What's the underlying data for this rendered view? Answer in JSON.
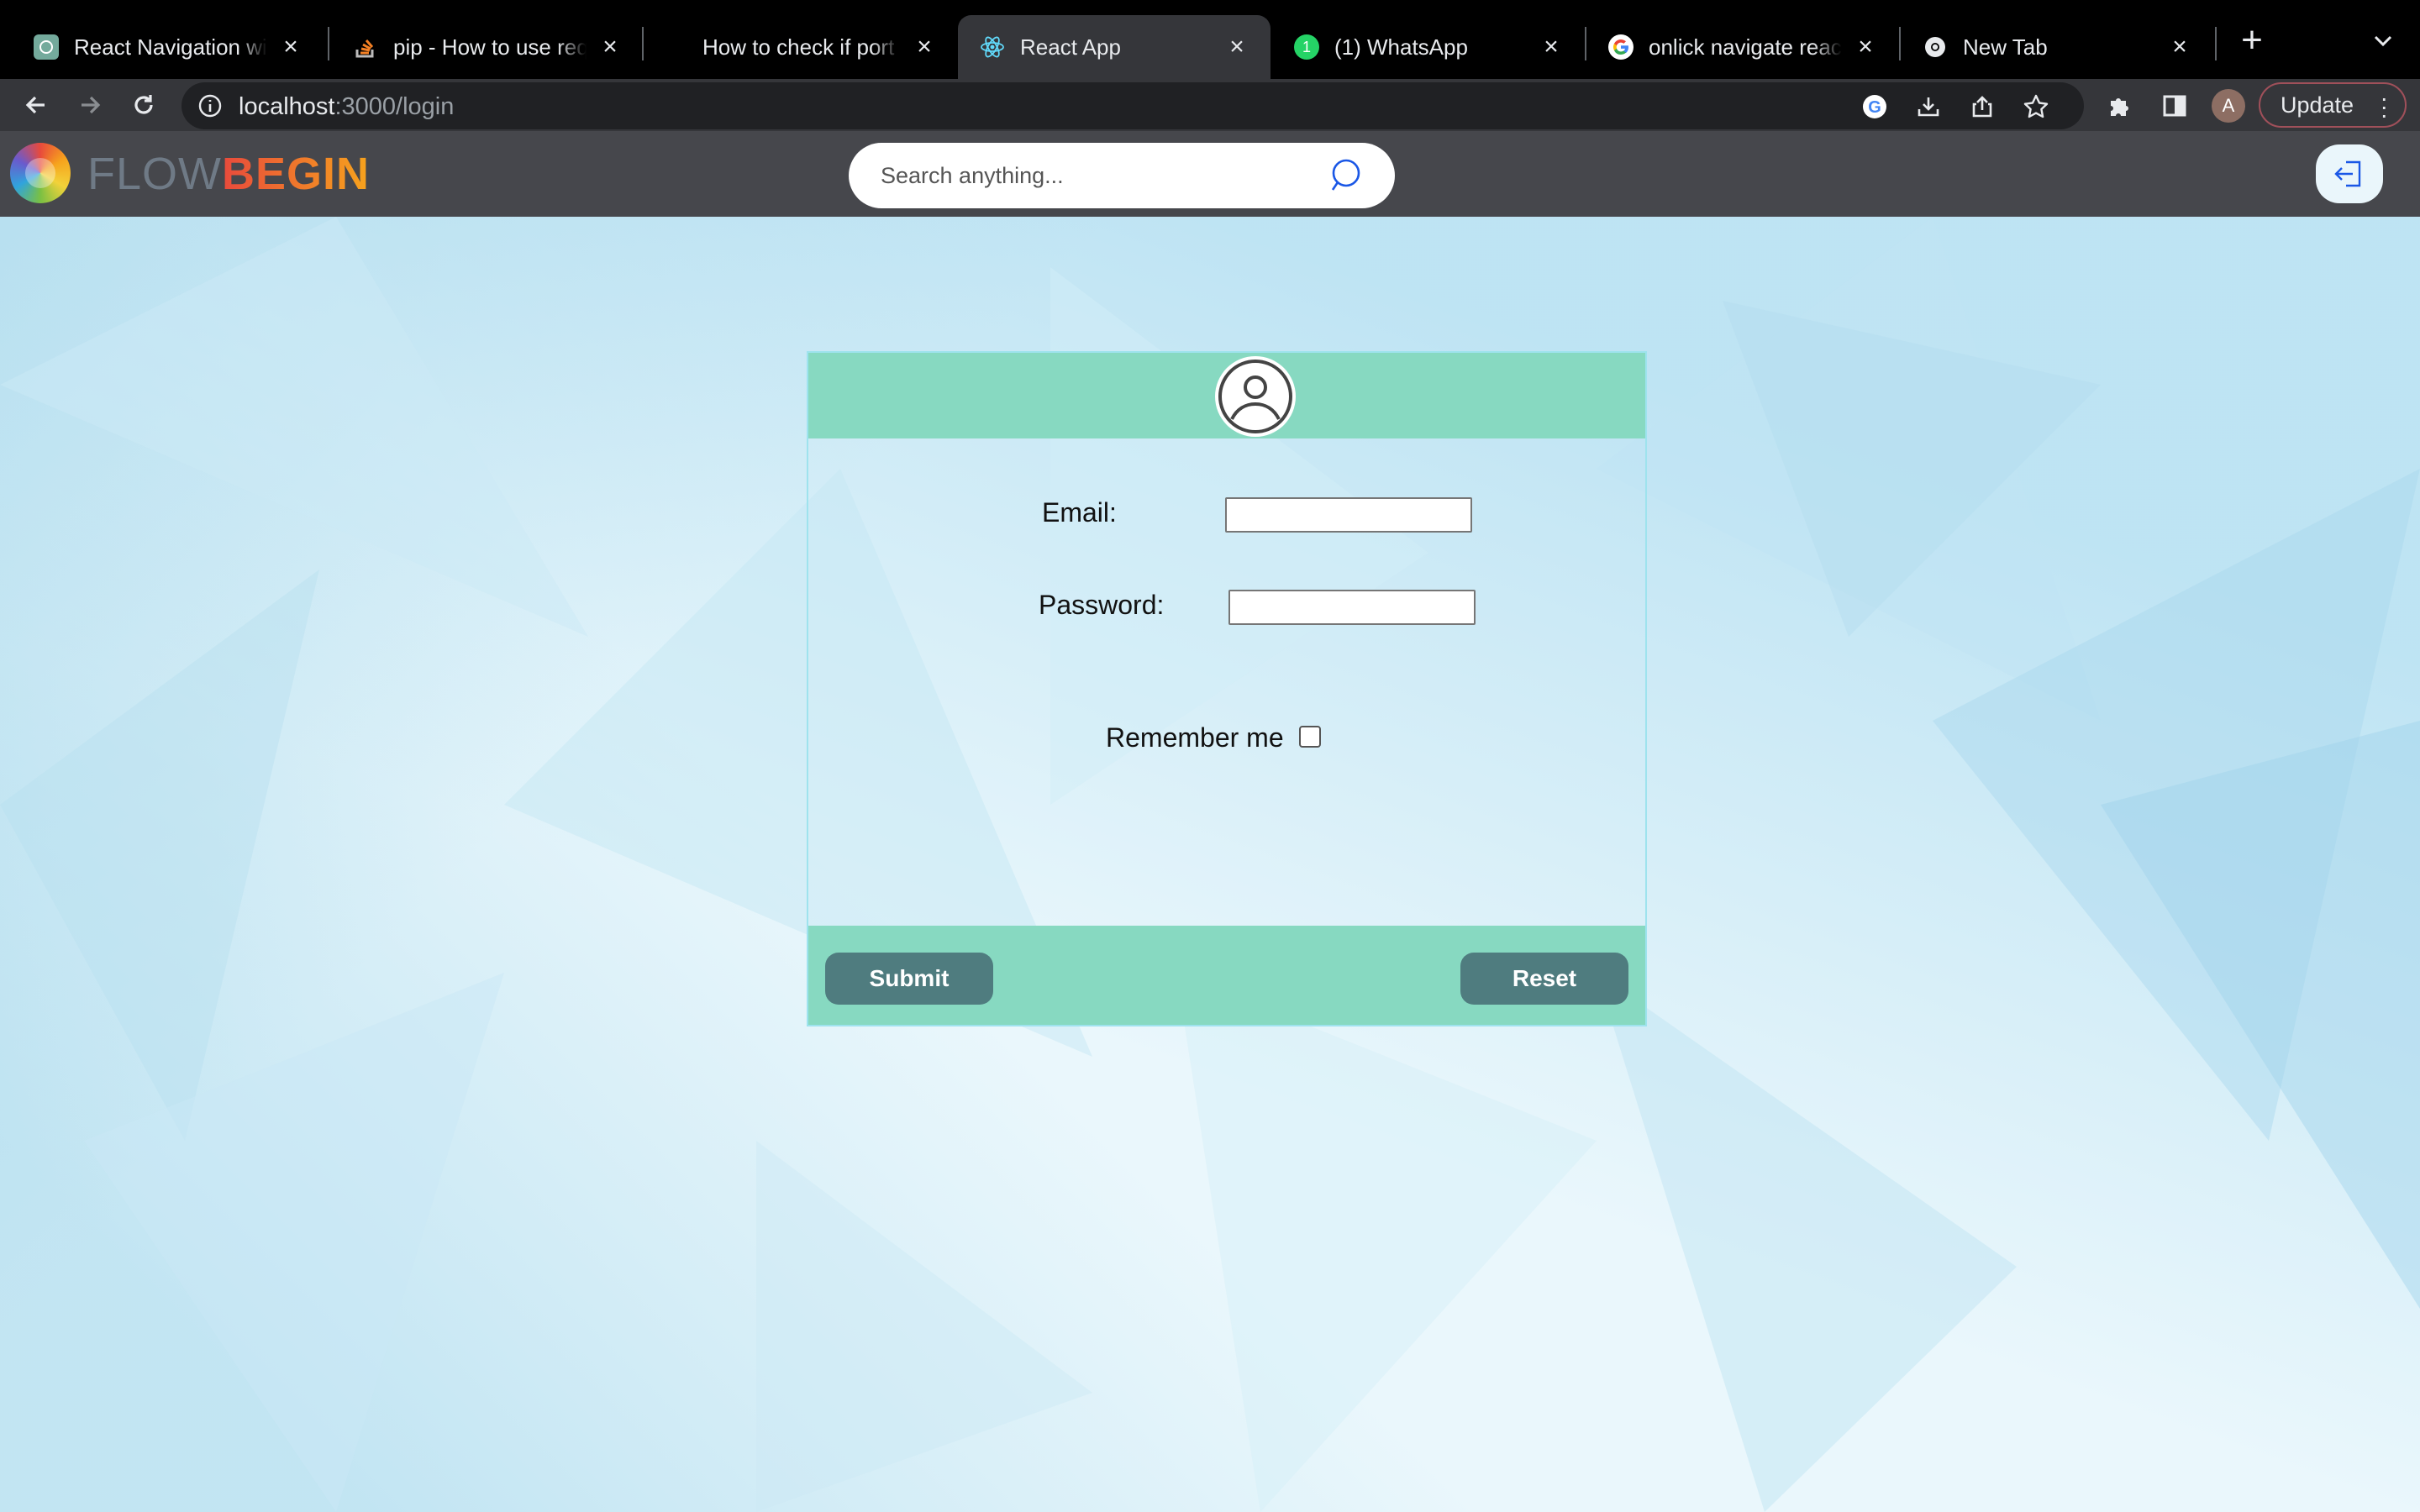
{
  "browser": {
    "tabs": [
      {
        "title": "React Navigation with",
        "favicon": "chatgpt-icon"
      },
      {
        "title": "pip - How to use requ",
        "favicon": "stackoverflow-icon"
      },
      {
        "title": "How to check if port i",
        "favicon": "none"
      },
      {
        "title": "React App",
        "favicon": "react-icon",
        "active": true
      },
      {
        "title": "(1) WhatsApp",
        "favicon": "whatsapp-icon"
      },
      {
        "title": "onlick navigate react",
        "favicon": "google-icon"
      },
      {
        "title": "New Tab",
        "favicon": "chrome-icon"
      }
    ],
    "url_host": "localhost",
    "url_rest": ":3000/login",
    "profile_initial": "A",
    "update_label": "Update"
  },
  "app": {
    "brand_light": "FLOW",
    "brand_bold": "BEGIN",
    "search_placeholder": "Search anything..."
  },
  "login": {
    "email_label": "Email:",
    "password_label": "Password:",
    "remember_label": "Remember me",
    "remember_checked": false,
    "submit_label": "Submit",
    "reset_label": "Reset"
  },
  "colors": {
    "header_bg": "#46474c",
    "card_band": "#87d9c1",
    "button": "#4f7c7f"
  }
}
